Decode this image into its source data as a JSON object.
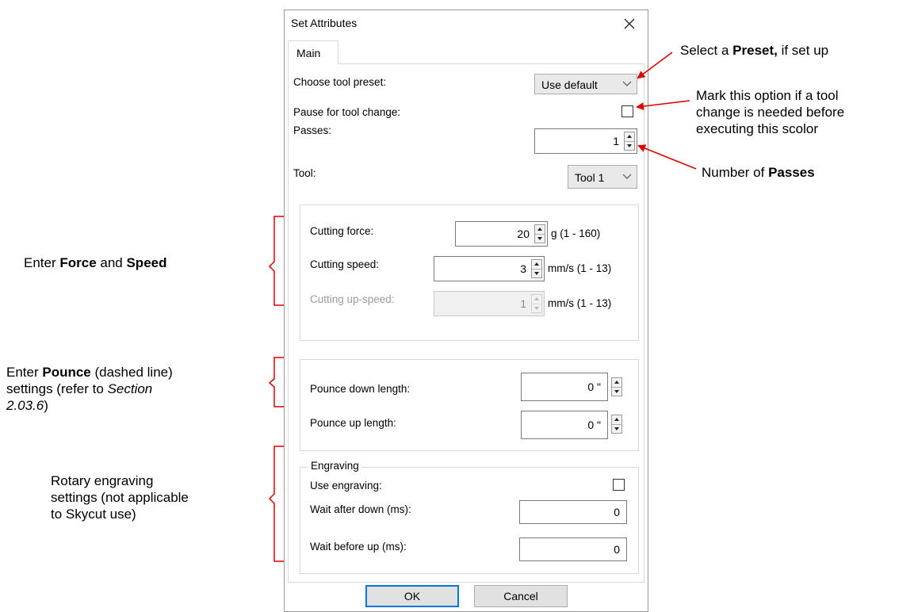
{
  "dialog": {
    "title": "Set Attributes",
    "tab_main": "Main",
    "preset_label": "Choose tool preset:",
    "preset_value": "Use default",
    "pause_label": "Pause for tool change:",
    "pause_checked": false,
    "passes_label": "Passes:",
    "passes_value": "1",
    "tool_label": "Tool:",
    "tool_value": "Tool 1",
    "force_label": "Cutting force:",
    "force_value": "20",
    "force_unit": "g (1 - 160)",
    "speed_label": "Cutting speed:",
    "speed_value": "3",
    "speed_unit": "mm/s (1 - 13)",
    "upspeed_label": "Cutting up-speed:",
    "upspeed_value": "1",
    "upspeed_unit": "mm/s (1 - 13)",
    "pounce_down_label": "Pounce down length:",
    "pounce_down_value": "0 \"",
    "pounce_up_label": "Pounce up length:",
    "pounce_up_value": "0 \"",
    "engraving_group": "Engraving",
    "use_engraving_label": "Use engraving:",
    "use_engraving_checked": false,
    "wait_down_label": "Wait after down (ms):",
    "wait_down_value": "0",
    "wait_up_label": "Wait before up (ms):",
    "wait_up_value": "0",
    "ok_label": "OK",
    "cancel_label": "Cancel"
  },
  "annotations": {
    "preset_pre": "Select a ",
    "preset_bold": "Preset,",
    "preset_post": " if set up",
    "pause_line1": "Mark this option if a tool",
    "pause_line2": "change is needed before",
    "pause_line3": "executing this scolor",
    "passes_pre": "Number of ",
    "passes_bold": "Passes",
    "force_pre": "Enter ",
    "force_bold1": "Force",
    "force_mid": " and ",
    "force_bold2": "Speed",
    "pounce_pre": "Enter ",
    "pounce_bold": "Pounce",
    "pounce_post": " (dashed line)",
    "pounce_line2_pre": "settings (refer to ",
    "pounce_line2_italic": "Section",
    "pounce_line3_italic": "2.03.6",
    "pounce_line3_post": ")",
    "rotary_line1": "Rotary engraving",
    "rotary_line2": "settings (not applicable",
    "rotary_line3": "to Skycut use)"
  },
  "colors": {
    "annotation_red": "#e00000",
    "focus_blue": "#0078d7"
  }
}
